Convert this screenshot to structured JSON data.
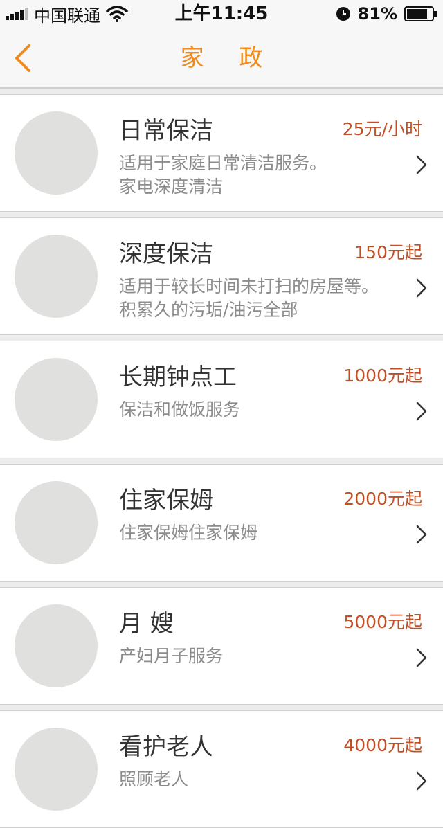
{
  "status_bar": {
    "carrier": "中国联通",
    "time": "上午11:45",
    "battery": "81%"
  },
  "nav": {
    "title": "家 政"
  },
  "services": [
    {
      "title": "日常保洁",
      "price": "25元/小时",
      "desc": [
        "适用于家庭日常清洁服务。",
        "家电深度清洁"
      ]
    },
    {
      "title": "深度保洁",
      "price": "150元起",
      "desc": [
        "适用于较长时间未打扫的房屋等。",
        "积累久的污垢/油污全部"
      ]
    },
    {
      "title": "长期钟点工",
      "price": "1000元起",
      "desc": [
        "保洁和做饭服务"
      ]
    },
    {
      "title": "住家保姆",
      "price": "2000元起",
      "desc": [
        "住家保姆住家保姆"
      ]
    },
    {
      "title": "月 嫂",
      "price": "5000元起",
      "desc": [
        "产妇月子服务"
      ]
    },
    {
      "title": "看护老人",
      "price": "4000元起",
      "desc": [
        "照顾老人"
      ]
    }
  ],
  "colors": {
    "accent": "#f08a1e",
    "price": "#c24f24",
    "avatar": "#e0e0df"
  }
}
